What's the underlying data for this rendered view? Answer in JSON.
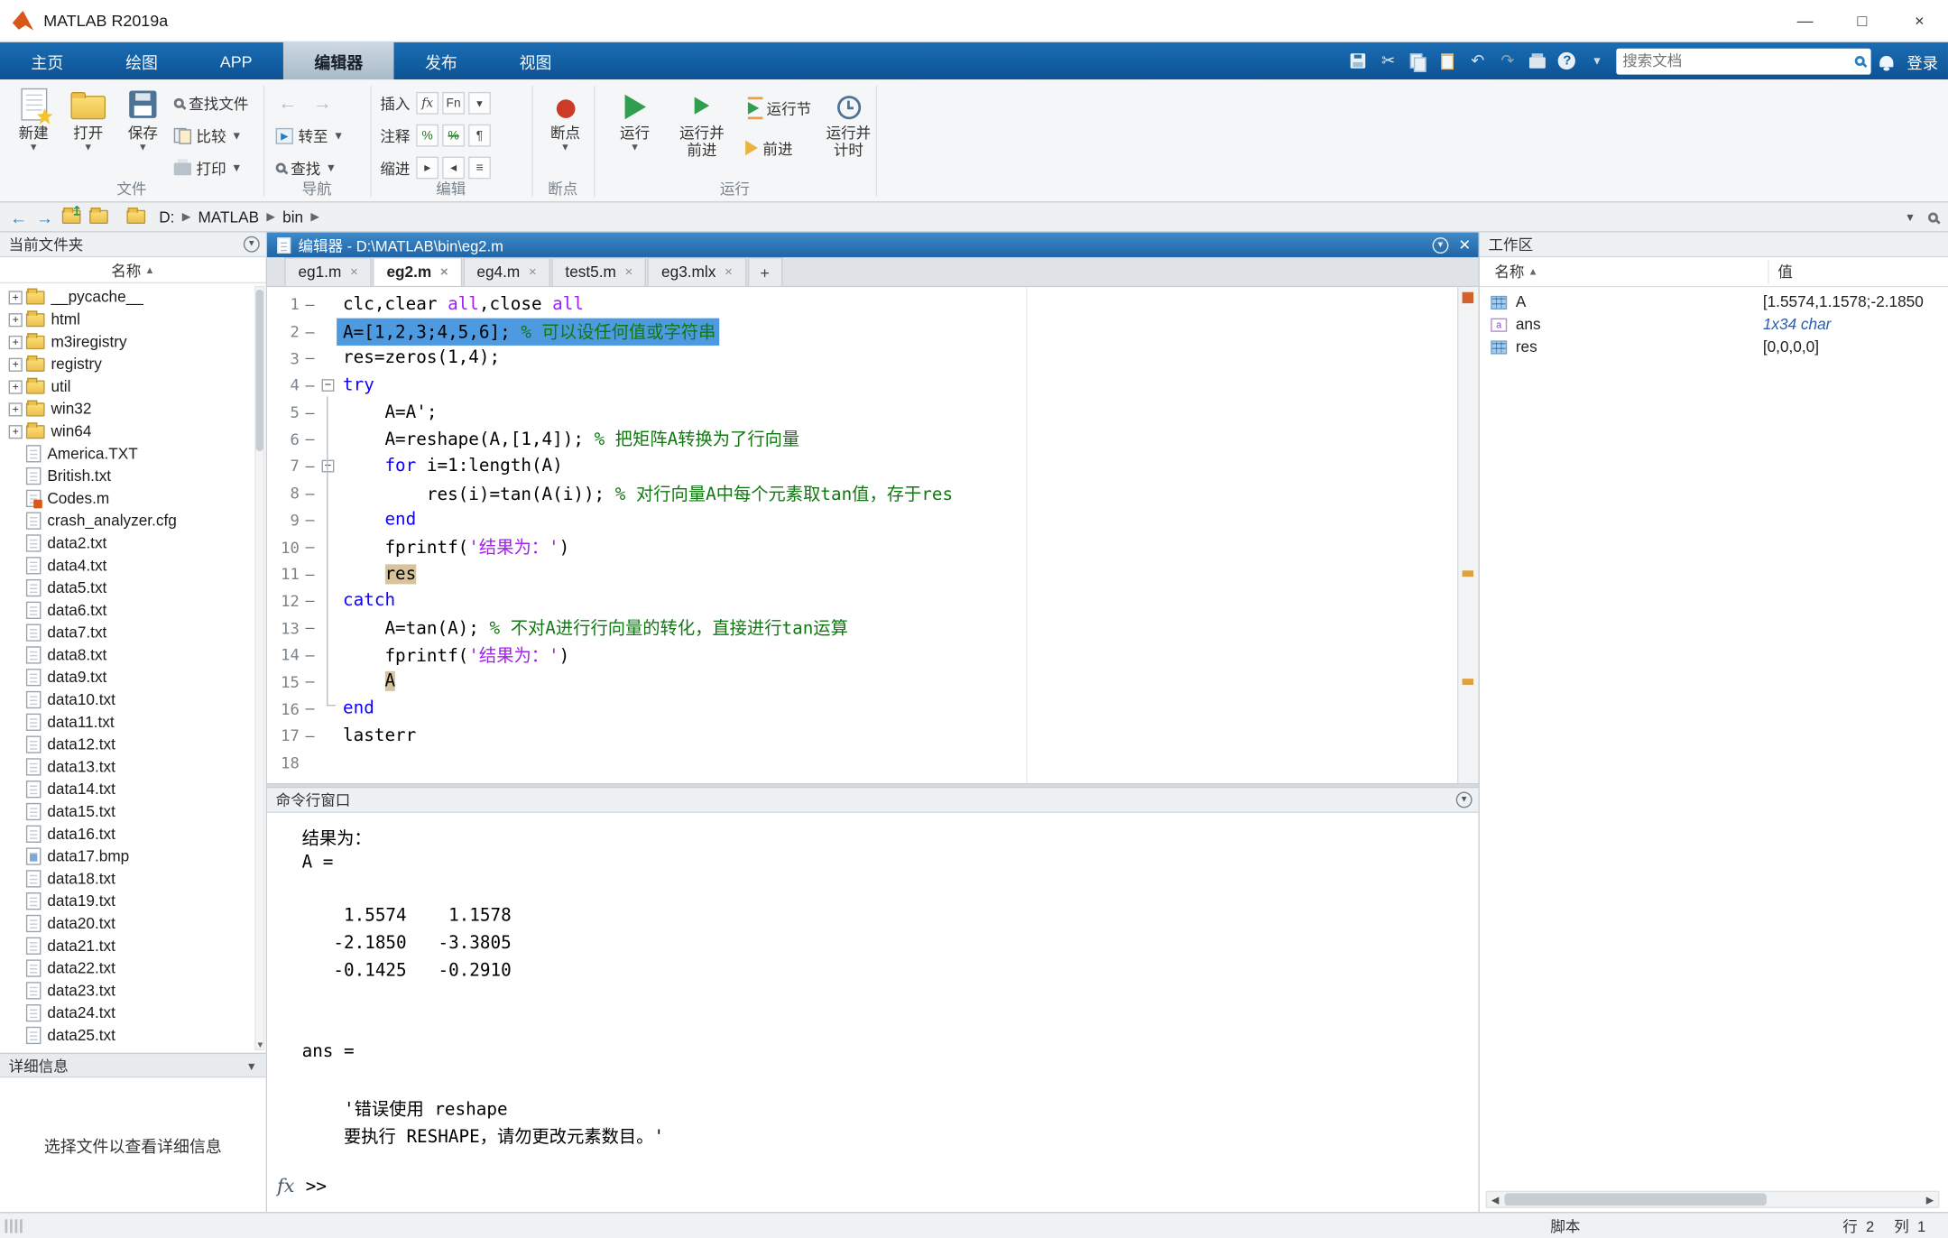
{
  "window": {
    "title": "MATLAB R2019a",
    "minimize": "—",
    "maximize": "□",
    "close": "×"
  },
  "ribbon": {
    "tabs": [
      {
        "label": "主页",
        "active": false
      },
      {
        "label": "绘图",
        "active": false
      },
      {
        "label": "APP",
        "active": false
      },
      {
        "label": "编辑器",
        "active": true
      },
      {
        "label": "发布",
        "active": false
      },
      {
        "label": "视图",
        "active": false
      }
    ],
    "quick_access_icons": [
      "save-icon",
      "cut-icon",
      "copy-icon",
      "paste-icon",
      "undo-icon",
      "redo-icon",
      "print-icon",
      "help-icon",
      "more-icon"
    ],
    "search_placeholder": "搜索文档",
    "signin": "登录",
    "group_labels": {
      "file": "文件",
      "navigate": "导航",
      "edit": "编辑",
      "breakpoints": "断点",
      "run": "运行"
    },
    "file": {
      "new": "新建",
      "open": "打开",
      "save": "保存",
      "find_files": "查找文件",
      "compare": "比较",
      "print": "打印"
    },
    "navigate": {
      "goto": "转至",
      "find": "查找"
    },
    "edit": {
      "insert": "插入",
      "comment": "注释",
      "indent": "缩进",
      "fx": "fx",
      "fn": "Fn",
      "percent": "%"
    },
    "breakpoints": {
      "label": "断点"
    },
    "run": {
      "run": "运行",
      "run_advance_1": "运行并",
      "run_advance_2": "前进",
      "run_section": "运行节",
      "advance": "前进",
      "run_time_1": "运行并",
      "run_time_2": "计时"
    }
  },
  "address": {
    "crumbs": [
      "D:",
      "MATLAB",
      "bin"
    ]
  },
  "current_folder": {
    "title": "当前文件夹",
    "name_header": "名称",
    "items": [
      {
        "label": "__pycache__",
        "kind": "folder"
      },
      {
        "label": "html",
        "kind": "folder"
      },
      {
        "label": "m3iregistry",
        "kind": "folder"
      },
      {
        "label": "registry",
        "kind": "folder"
      },
      {
        "label": "util",
        "kind": "folder"
      },
      {
        "label": "win32",
        "kind": "folder"
      },
      {
        "label": "win64",
        "kind": "folder"
      },
      {
        "label": "America.TXT",
        "kind": "txt"
      },
      {
        "label": "British.txt",
        "kind": "txt"
      },
      {
        "label": "Codes.m",
        "kind": "m"
      },
      {
        "label": "crash_analyzer.cfg",
        "kind": "cfg"
      },
      {
        "label": "data2.txt",
        "kind": "txt"
      },
      {
        "label": "data4.txt",
        "kind": "txt"
      },
      {
        "label": "data5.txt",
        "kind": "txt"
      },
      {
        "label": "data6.txt",
        "kind": "txt"
      },
      {
        "label": "data7.txt",
        "kind": "txt"
      },
      {
        "label": "data8.txt",
        "kind": "txt"
      },
      {
        "label": "data9.txt",
        "kind": "txt"
      },
      {
        "label": "data10.txt",
        "kind": "txt"
      },
      {
        "label": "data11.txt",
        "kind": "txt"
      },
      {
        "label": "data12.txt",
        "kind": "txt"
      },
      {
        "label": "data13.txt",
        "kind": "txt"
      },
      {
        "label": "data14.txt",
        "kind": "txt"
      },
      {
        "label": "data15.txt",
        "kind": "txt"
      },
      {
        "label": "data16.txt",
        "kind": "txt"
      },
      {
        "label": "data17.bmp",
        "kind": "bmp"
      },
      {
        "label": "data18.txt",
        "kind": "txt"
      },
      {
        "label": "data19.txt",
        "kind": "txt"
      },
      {
        "label": "data20.txt",
        "kind": "txt"
      },
      {
        "label": "data21.txt",
        "kind": "txt"
      },
      {
        "label": "data22.txt",
        "kind": "txt"
      },
      {
        "label": "data23.txt",
        "kind": "txt"
      },
      {
        "label": "data24.txt",
        "kind": "txt"
      },
      {
        "label": "data25.txt",
        "kind": "txt"
      }
    ],
    "details_title": "详细信息",
    "details_text": "选择文件以查看详细信息"
  },
  "editor": {
    "title": "编辑器 - D:\\MATLAB\\bin\\eg2.m",
    "tabs": [
      {
        "label": "eg1.m",
        "active": false
      },
      {
        "label": "eg2.m",
        "active": true
      },
      {
        "label": "eg4.m",
        "active": false
      },
      {
        "label": "test5.m",
        "active": false
      },
      {
        "label": "eg3.mlx",
        "active": false
      }
    ],
    "lines": [
      {
        "n": 1,
        "dash": true,
        "segs": [
          [
            "p",
            "clc,clear "
          ],
          [
            "s",
            "all"
          ],
          [
            "p",
            ",close "
          ],
          [
            "s",
            "all"
          ]
        ]
      },
      {
        "n": 2,
        "dash": true,
        "sel": true,
        "segs": [
          [
            "p",
            "A=[1,2,3;4,5,6]; "
          ],
          [
            "c",
            "% 可以设任何值或字符串"
          ]
        ]
      },
      {
        "n": 3,
        "dash": true,
        "segs": [
          [
            "p",
            "res=zeros(1,4);"
          ]
        ]
      },
      {
        "n": 4,
        "dash": true,
        "fold": true,
        "segs": [
          [
            "k",
            "try"
          ]
        ]
      },
      {
        "n": 5,
        "dash": true,
        "segs": [
          [
            "p",
            "    A=A';"
          ]
        ]
      },
      {
        "n": 6,
        "dash": true,
        "segs": [
          [
            "p",
            "    A=reshape(A,[1,4]); "
          ],
          [
            "c",
            "% 把矩阵A转换为了行向量"
          ]
        ]
      },
      {
        "n": 7,
        "dash": true,
        "fold": true,
        "segs": [
          [
            "p",
            "    "
          ],
          [
            "k",
            "for"
          ],
          [
            "p",
            " i=1:length(A)"
          ]
        ]
      },
      {
        "n": 8,
        "dash": true,
        "segs": [
          [
            "p",
            "        res(i)=tan(A(i)); "
          ],
          [
            "c",
            "% 对行向量A中每个元素取tan值，存于res"
          ]
        ]
      },
      {
        "n": 9,
        "dash": true,
        "segs": [
          [
            "p",
            "    "
          ],
          [
            "k",
            "end"
          ]
        ]
      },
      {
        "n": 10,
        "dash": true,
        "segs": [
          [
            "p",
            "    fprintf("
          ],
          [
            "s",
            "'结果为：'"
          ],
          [
            "p",
            ")"
          ]
        ]
      },
      {
        "n": 11,
        "dash": true,
        "segs": [
          [
            "p",
            "    "
          ],
          [
            "hl",
            "res"
          ]
        ]
      },
      {
        "n": 12,
        "dash": true,
        "segs": [
          [
            "k",
            "catch"
          ]
        ]
      },
      {
        "n": 13,
        "dash": true,
        "segs": [
          [
            "p",
            "    A=tan(A); "
          ],
          [
            "c",
            "% 不对A进行行向量的转化，直接进行tan运算"
          ]
        ]
      },
      {
        "n": 14,
        "dash": true,
        "segs": [
          [
            "p",
            "    fprintf("
          ],
          [
            "s",
            "'结果为：'"
          ],
          [
            "p",
            ")"
          ]
        ]
      },
      {
        "n": 15,
        "dash": true,
        "segs": [
          [
            "p",
            "    "
          ],
          [
            "hl",
            "A"
          ]
        ]
      },
      {
        "n": 16,
        "dash": true,
        "segs": [
          [
            "k",
            "end"
          ]
        ]
      },
      {
        "n": 17,
        "dash": true,
        "segs": [
          [
            "p",
            "lasterr"
          ]
        ]
      },
      {
        "n": 18,
        "dash": false,
        "segs": []
      }
    ]
  },
  "command_window": {
    "title": "命令行窗口",
    "lines": [
      "结果为：",
      "A =",
      "",
      "    1.5574    1.1578",
      "   -2.1850   -3.3805",
      "   -0.1425   -0.2910",
      "",
      "",
      "ans =",
      "",
      "    '错误使用 reshape",
      "    要执行 RESHAPE，请勿更改元素数目。'"
    ],
    "prompt_fx": "fx",
    "prompt": ">>"
  },
  "workspace": {
    "title": "工作区",
    "col_name": "名称",
    "col_value": "值",
    "rows": [
      {
        "name": "A",
        "icon": "matrix",
        "value": "[1.5574,1.1578;-2.1850",
        "italic": false
      },
      {
        "name": "ans",
        "icon": "char",
        "value": "1x34 char",
        "italic": true
      },
      {
        "name": "res",
        "icon": "matrix",
        "value": "[0,0,0,0]",
        "italic": false
      }
    ]
  },
  "status_bar": {
    "script": "脚本",
    "line_label": "行",
    "line": "2",
    "col_label": "列",
    "col": "1"
  }
}
